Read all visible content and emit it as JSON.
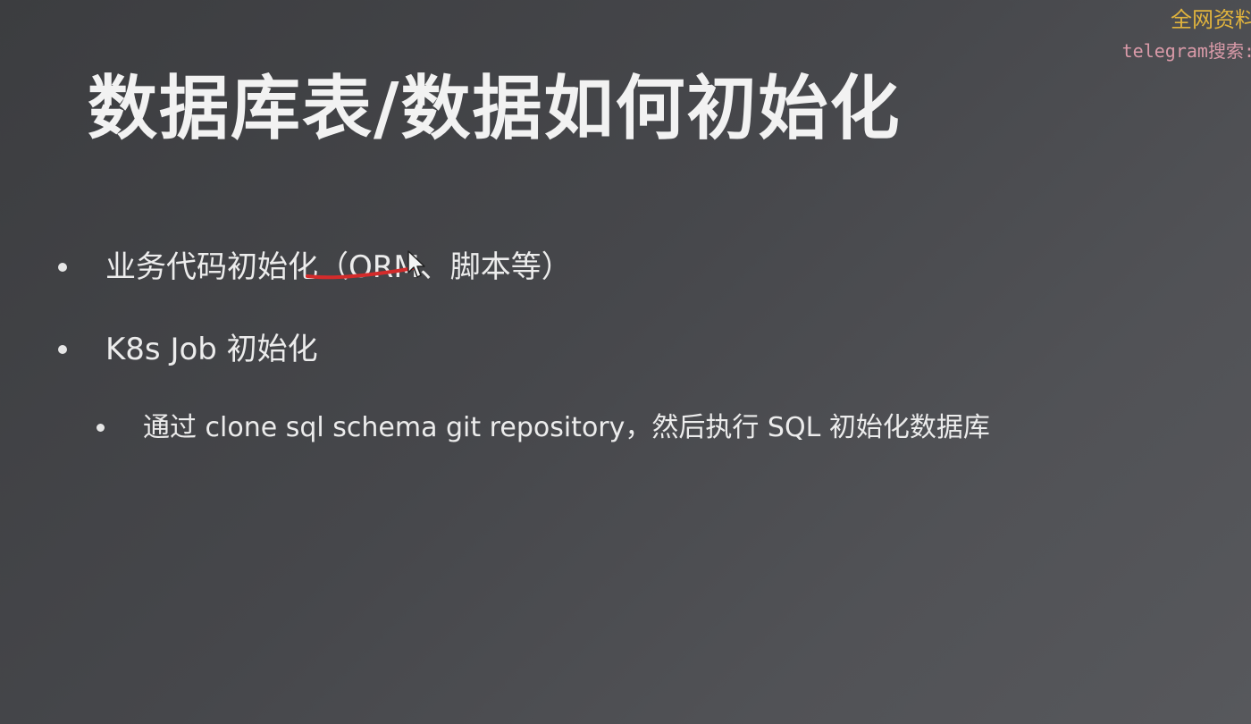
{
  "watermark": {
    "line1": "全网资料",
    "line2": "telegram搜索:",
    "line1_color": "#e0b33d",
    "line2_color": "#d99aa8"
  },
  "slide": {
    "title": "数据库表/数据如何初始化",
    "bullets": [
      {
        "text": "业务代码初始化（ORM、脚本等）",
        "level": 1
      },
      {
        "text": "K8s Job 初始化",
        "level": 1
      },
      {
        "text": "通过 clone sql schema git repository，然后执行 SQL 初始化数据库",
        "level": 2
      }
    ]
  },
  "annotation": {
    "stroke_color": "#d42b2b"
  },
  "cursor": {
    "icon": "pointer-cursor-icon"
  },
  "colors": {
    "background": "#46474b",
    "text": "#ececec"
  }
}
